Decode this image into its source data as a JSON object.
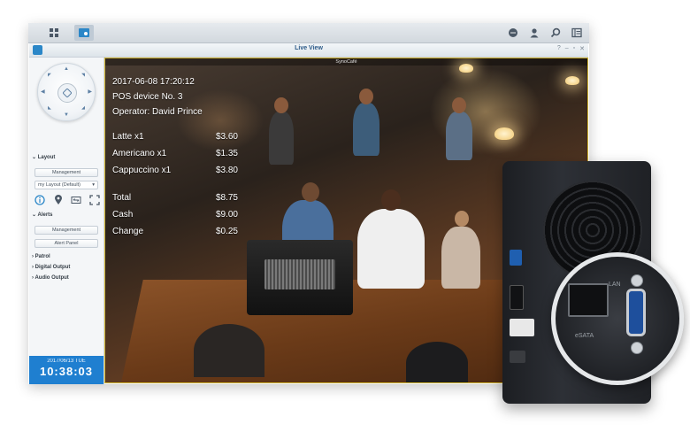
{
  "window": {
    "title": "Live View"
  },
  "taskbar": {
    "apps": [
      "main-menu",
      "surveillance-app"
    ]
  },
  "sidebar": {
    "layout_header": "Layout",
    "management_label": "Management",
    "layout_select": "my Layout (Default)",
    "alerts_header": "Alerts",
    "alerts_management_label": "Management",
    "alert_panel_label": "Alert Panel",
    "patrol_label": "Patrol",
    "digital_output_label": "Digital Output",
    "audio_output_label": "Audio Output",
    "date": "2017/06/13  TUE",
    "time": "10:38:03"
  },
  "camera": {
    "name": "SynoCafé",
    "timestamp": "2017-06-08 17:20:12",
    "pos_device": "POS device No. 3",
    "operator": "Operator:  David Prince",
    "items": [
      {
        "name": "Latte x1",
        "price": "$3.60"
      },
      {
        "name": "Americano x1",
        "price": "$1.35"
      },
      {
        "name": "Cappuccino x1",
        "price": "$3.80"
      }
    ],
    "totals": [
      {
        "name": "Total",
        "price": "$8.75"
      },
      {
        "name": "Cash",
        "price": "$9.00"
      },
      {
        "name": "Change",
        "price": "$0.25"
      }
    ]
  },
  "device": {
    "lan_label": "LAN",
    "esata_label": "eSATA"
  },
  "colors": {
    "accent": "#1f7fd0",
    "selection_border": "#d2b530",
    "serial_port": "#1e4f9c"
  }
}
